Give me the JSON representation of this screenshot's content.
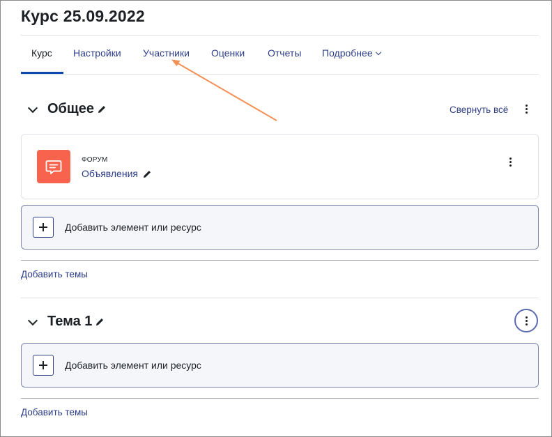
{
  "course": {
    "title": "Курс 25.09.2022"
  },
  "tabs": [
    {
      "label": "Курс"
    },
    {
      "label": "Настройки"
    },
    {
      "label": "Участники"
    },
    {
      "label": "Оценки"
    },
    {
      "label": "Отчеты"
    },
    {
      "label": "Подробнее"
    }
  ],
  "sections": [
    {
      "title": "Общее",
      "collapse_label": "Свернуть всё",
      "activity": {
        "type": "ФОРУМ",
        "name": "Объявления",
        "icon": "forum-icon"
      },
      "add_label": "Добавить элемент или ресурс",
      "add_topics_label": "Добавить темы"
    },
    {
      "title": "Тема 1",
      "add_label": "Добавить элемент или ресурс",
      "add_topics_label": "Добавить темы"
    }
  ],
  "colors": {
    "link": "#2d3e87",
    "active_tab_underline": "#0f47ad",
    "forum_icon_bg": "#f7634d",
    "annotation_arrow": "#f39055"
  }
}
